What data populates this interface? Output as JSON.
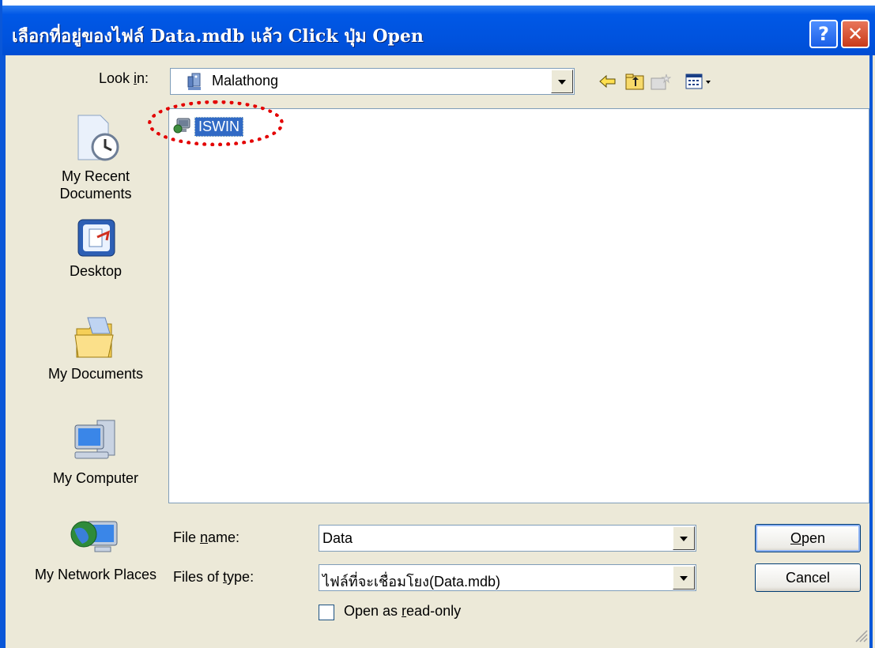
{
  "window": {
    "title": "เลือกที่อยู่ของไฟล์ Data.mdb แล้ว Click ปุ่ม Open",
    "help_label": "?",
    "close_label": "✕"
  },
  "lookin": {
    "label_pre": "Look ",
    "label_accel": "i",
    "label_post": "n:",
    "value": "Malathong"
  },
  "toolbar": {
    "icons": [
      "back-arrow-icon",
      "up-folder-icon",
      "new-folder-icon",
      "view-menu-icon"
    ]
  },
  "places": [
    {
      "label": "My Recent Documents",
      "icon": "recent-documents-icon"
    },
    {
      "label": "Desktop",
      "icon": "desktop-icon"
    },
    {
      "label": "My Documents",
      "icon": "my-documents-icon"
    },
    {
      "label": "My Computer",
      "icon": "my-computer-icon"
    },
    {
      "label": "My Network Places",
      "icon": "network-places-icon"
    }
  ],
  "file_list": {
    "items": [
      {
        "label": "ISWIN",
        "icon": "network-computer-icon",
        "selected": true
      }
    ]
  },
  "file_name": {
    "label_pre": "File ",
    "label_accel": "n",
    "label_post": "ame:",
    "value": "Data"
  },
  "file_type": {
    "label_pre": "Files of ",
    "label_accel": "t",
    "label_post": "ype:",
    "value": "ไฟล์ที่จะเชื่อมโยง(Data.mdb)"
  },
  "readonly": {
    "label_pre": "Open as ",
    "label_accel": "r",
    "label_post": "ead-only",
    "checked": false
  },
  "buttons": {
    "open_accel": "O",
    "open_rest": "pen",
    "cancel": "Cancel"
  },
  "annotation_color": "#E30000"
}
